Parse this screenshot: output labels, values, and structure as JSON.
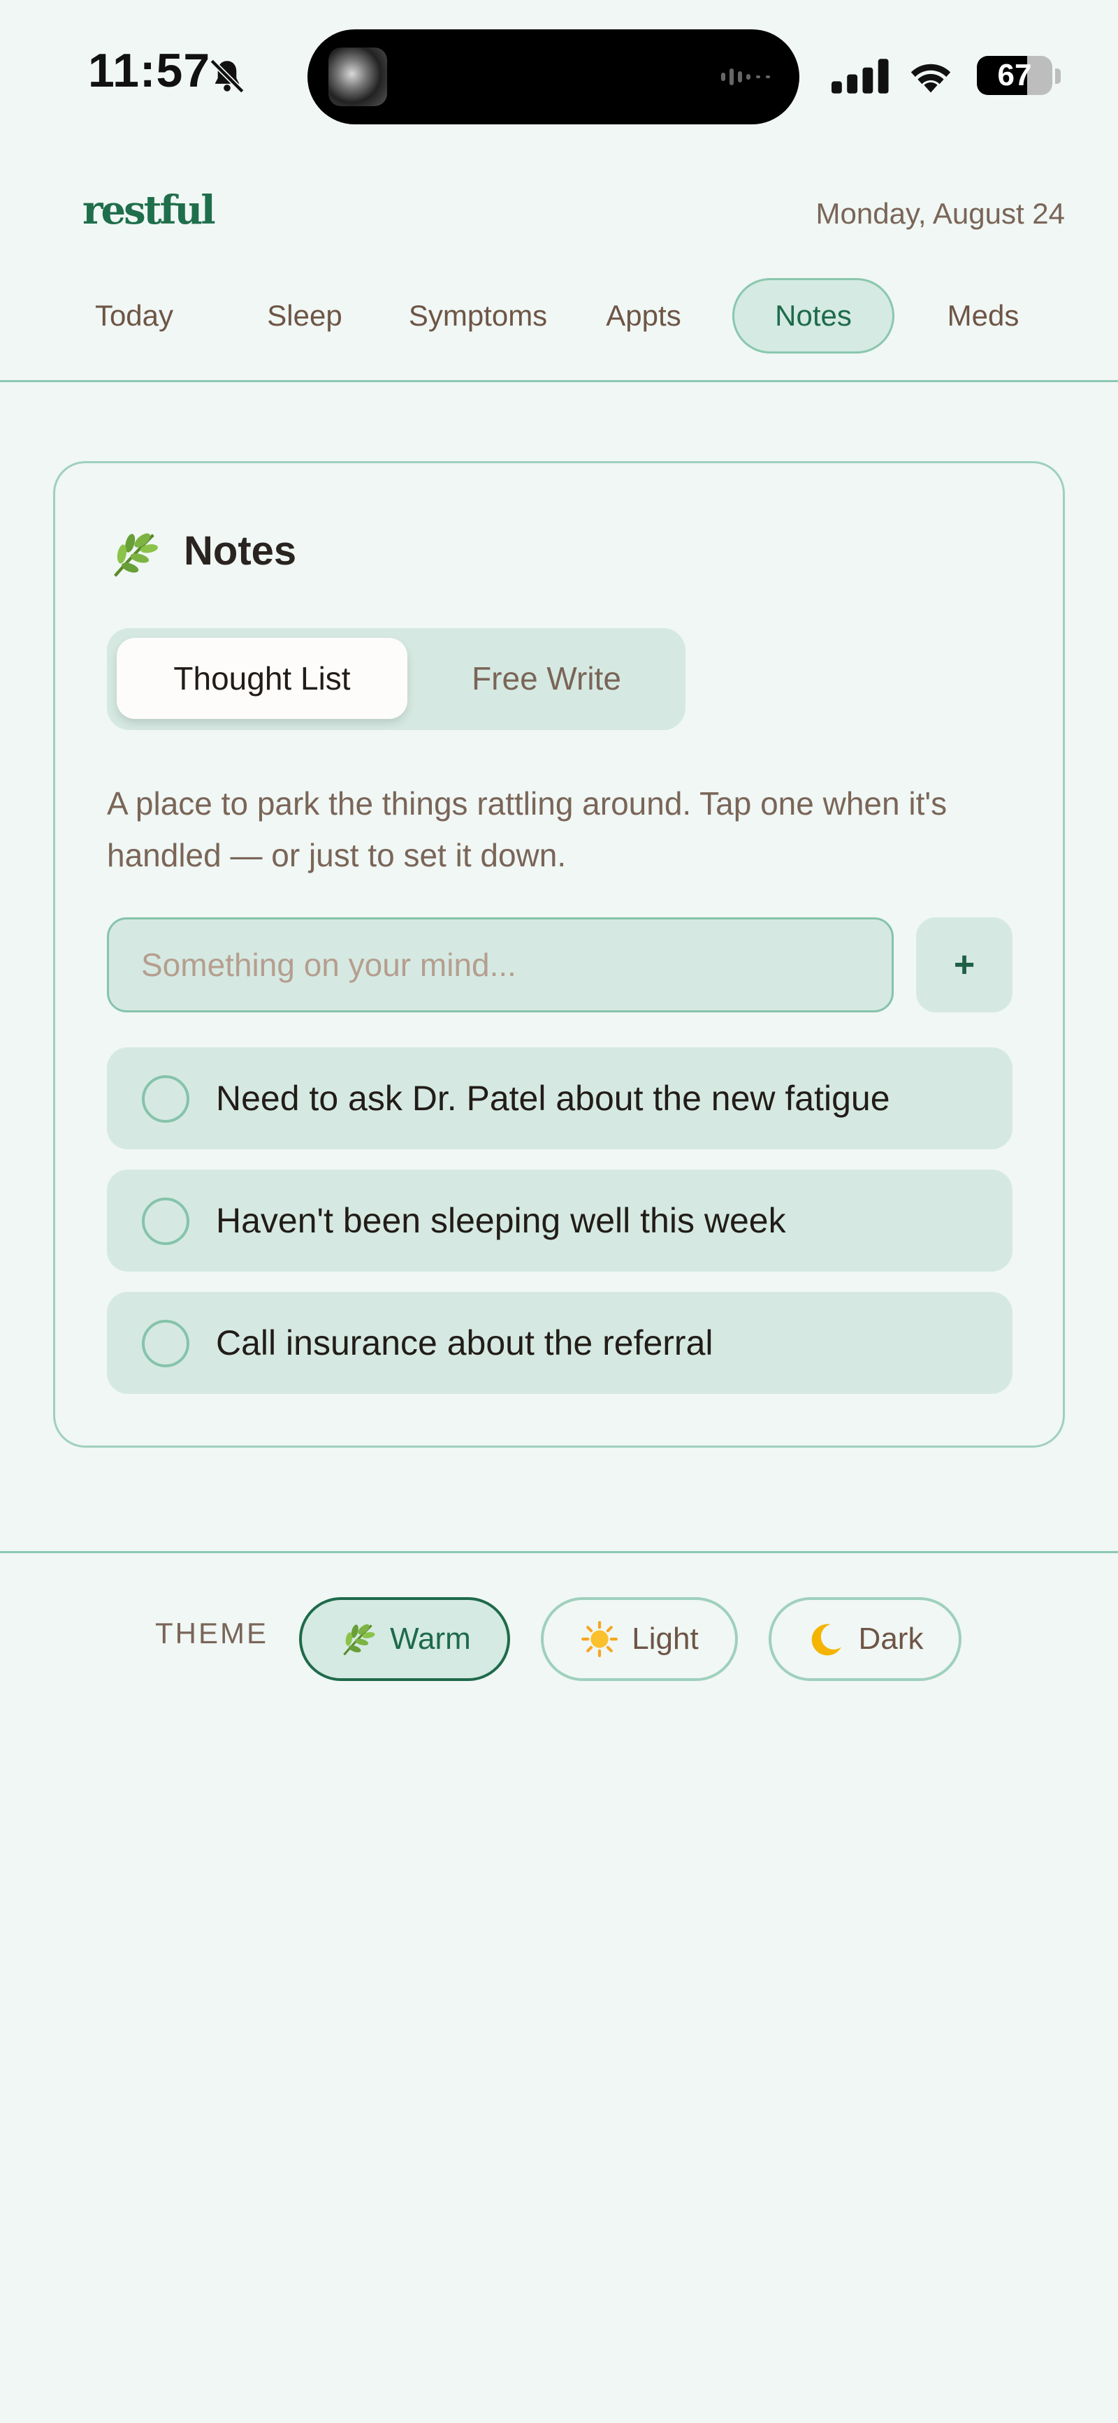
{
  "status_bar": {
    "time": "11:57",
    "battery_level": "67",
    "icons": [
      "bell-slash-icon",
      "cellular-signal-icon",
      "wifi-icon",
      "battery-icon"
    ]
  },
  "header": {
    "logo": "restful",
    "date": "Monday, August 24"
  },
  "nav": {
    "tabs": [
      {
        "label": "Today"
      },
      {
        "label": "Sleep"
      },
      {
        "label": "Symptoms"
      },
      {
        "label": "Appts"
      },
      {
        "label": "Notes",
        "active": true
      },
      {
        "label": "Meds"
      }
    ]
  },
  "notes_card": {
    "icon": "herb-icon",
    "title": "Notes",
    "modes": [
      {
        "label": "Thought List",
        "active": true
      },
      {
        "label": "Free Write"
      }
    ],
    "description": "A place to park the things rattling around. Tap one when it's handled — or just to set it down.",
    "input": {
      "value": "",
      "placeholder": "Something on your mind..."
    },
    "add_label": "+",
    "thoughts": [
      {
        "text": "Need to ask Dr. Patel about the new fatigue",
        "done": false
      },
      {
        "text": "Haven't been sleeping well this week",
        "done": false
      },
      {
        "text": "Call insurance about the referral",
        "done": false
      }
    ]
  },
  "theme": {
    "label": "THEME",
    "options": [
      {
        "label": "Warm",
        "icon": "herb-icon",
        "active": true
      },
      {
        "label": "Light",
        "icon": "sun-icon"
      },
      {
        "label": "Dark",
        "icon": "crescent-moon-icon"
      }
    ]
  },
  "colors": {
    "background": "#f0f7f4",
    "accent": "#1f6e4c",
    "panel": "#d5e9e2",
    "border": "#8ac7ae",
    "muted_text": "#7a6558"
  }
}
